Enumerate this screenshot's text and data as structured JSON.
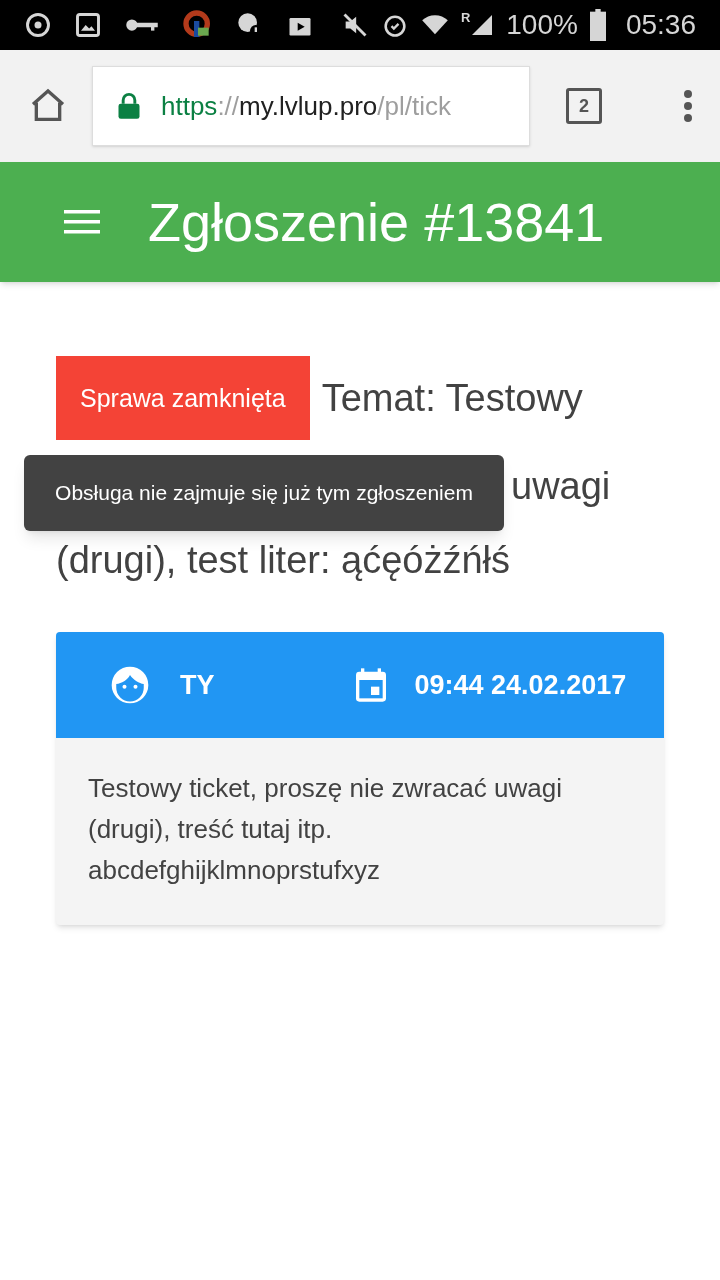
{
  "status_bar": {
    "signal_letter": "R",
    "battery": "100%",
    "time": "05:36"
  },
  "browser": {
    "url_parts": [
      {
        "kind": "scheme",
        "text": "https"
      },
      {
        "kind": "separator",
        "text": "://"
      },
      {
        "kind": "host",
        "text": "my.lvlup.pro"
      },
      {
        "kind": "path",
        "text": "/pl/tick"
      }
    ],
    "tab_count": "2"
  },
  "app_bar": {
    "title": "Zgłoszenie #13841"
  },
  "ticket": {
    "status": "Sprawa zamknięta",
    "title_lines": [
      "Temat: Testowy",
      "uwagi",
      "(drugi), test liter: ąćęóżźńłś"
    ],
    "tooltip": "Obsługa nie zajmuje się już tym zgłoszeniem"
  },
  "message": {
    "author": "TY",
    "date": "09:44 24.02.2017",
    "body": "Testowy ticket, proszę nie zwracać uwagi (drugi), treść tutaj itp. abcdefghijklmnoprstufxyz"
  }
}
